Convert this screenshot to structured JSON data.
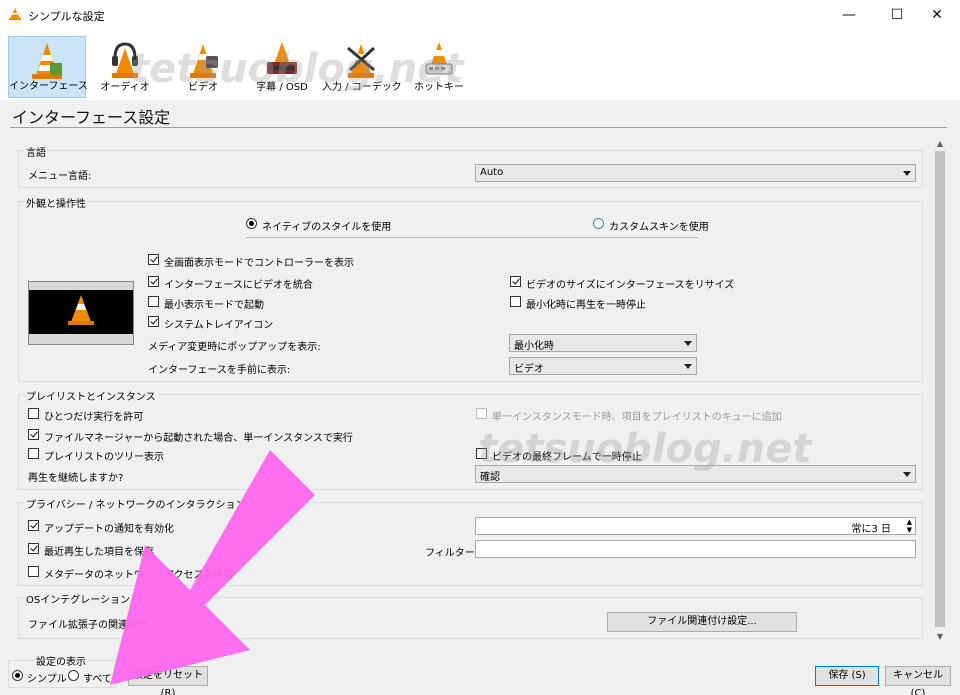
{
  "window": {
    "title": "シンプルな設定",
    "minimize": "—",
    "maximize": "☐",
    "close": "✕"
  },
  "categories": [
    {
      "label": "インターフェース",
      "icon": "interface-cone-icon",
      "selected": true
    },
    {
      "label": "オーディオ",
      "icon": "audio-headphones-cone-icon"
    },
    {
      "label": "ビデオ",
      "icon": "video-cone-icon"
    },
    {
      "label": "字幕 / OSD",
      "icon": "subtitle-cone-icon"
    },
    {
      "label": "入力 / コーデック",
      "icon": "input-codec-cone-icon"
    },
    {
      "label": "ホットキー",
      "icon": "hotkey-cone-icon"
    }
  ],
  "page_title": "インターフェース設定",
  "language": {
    "group": "言語",
    "menu_label": "メニュー言語:",
    "menu_value": "Auto"
  },
  "appearance": {
    "group": "外観と操作性",
    "native_style": "ネイティブのスタイルを使用",
    "custom_skin": "カスタムスキンを使用",
    "fullscreen_controller": "全画面表示モードでコントローラーを表示",
    "embed_video": "インターフェースにビデオを統合",
    "resize_interface": "ビデオのサイズにインターフェースをリサイズ",
    "minimal_mode": "最小表示モードで起動",
    "pause_minimized": "最小化時に再生を一時停止",
    "systray": "システムトレイアイコン",
    "popup_label": "メディア変更時にポップアップを表示:",
    "popup_value": "最小化時",
    "on_top_label": "インターフェースを手前に表示:",
    "on_top_value": "ビデオ"
  },
  "playlist": {
    "group": "プレイリストとインスタンス",
    "one_instance": "ひとつだけ実行を許可",
    "enqueue": "単一インスタンスモード時、項目をプレイリストのキューに追加",
    "file_manager": "ファイルマネージャーから起動された場合、単一インスタンスで実行",
    "tree": "プレイリストのツリー表示",
    "pause_last_frame": "ビデオの最終フレームで一時停止",
    "continue_label": "再生を継続しますか?",
    "continue_value": "確認"
  },
  "privacy": {
    "group": "プライバシー / ネットワークのインタラクション",
    "update_check": "アップデートの通知を有効化",
    "update_interval": "常に3 日",
    "recent": "最近再生した項目を保存",
    "filter_label": "フィルター:",
    "metadata": "メタデータのネットワークアクセスを許可"
  },
  "os": {
    "group": "OSインテグレーション",
    "file_ext_label": "ファイル拡張子の関連付け",
    "file_assoc_button": "ファイル関連付け設定..."
  },
  "footer": {
    "show_settings": "設定の表示",
    "simple": "シンプル",
    "all": "すべて",
    "reset": "設定をリセット (R)",
    "save": "保存 (S)",
    "cancel": "キャンセル (C)"
  },
  "watermark": "tetsuoblog.net",
  "colors": {
    "selected_tab": "#cce4f7",
    "arrow": "#ff66ee"
  }
}
